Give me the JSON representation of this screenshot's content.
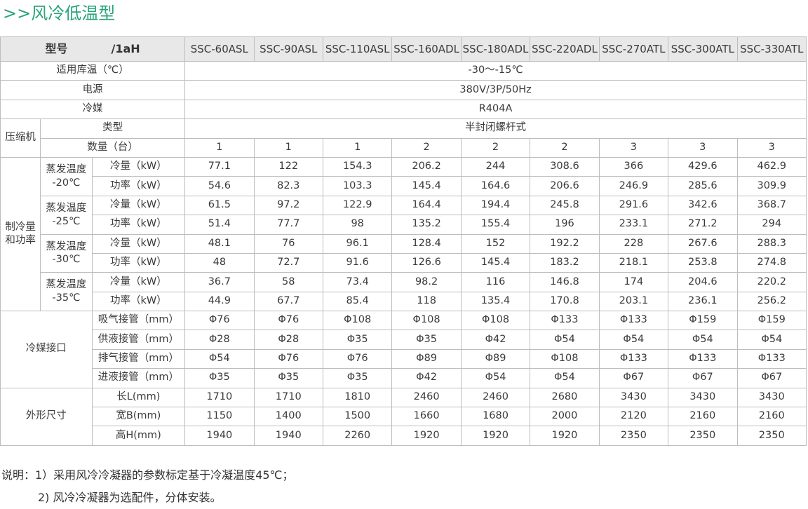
{
  "page_title": ">>风冷低温型",
  "table": {
    "header_label_a": "型号",
    "header_label_b": "/1aH",
    "models": [
      "SSC-60ASL",
      "SSC-90ASL",
      "SSC-110ASL",
      "SSC-160ADL",
      "SSC-180ADL",
      "SSC-220ADL",
      "SSC-270ATL",
      "SSC-300ATL",
      "SSC-330ATL"
    ],
    "common": [
      {
        "label": "适用库温（℃）",
        "value": "-30～-15℃"
      },
      {
        "label": "电源",
        "value": "380V/3P/50Hz"
      },
      {
        "label": "冷媒",
        "value": "R404A"
      }
    ],
    "compressor": {
      "group": "压缩机",
      "type_label": "类型",
      "type_value": "半封闭螺杆式",
      "count_label": "数量（台）",
      "count_values": [
        "1",
        "1",
        "1",
        "2",
        "2",
        "2",
        "3",
        "3",
        "3"
      ]
    },
    "capacity": {
      "group": "制冷量和功率",
      "row_labels": {
        "cool": "冷量（kW）",
        "power": "功率（kW）"
      },
      "temps": [
        {
          "label_line1": "蒸发温度",
          "label_line2": "-20℃",
          "cool": [
            "77.1",
            "122",
            "154.3",
            "206.2",
            "244",
            "308.6",
            "366",
            "429.6",
            "462.9"
          ],
          "power": [
            "54.6",
            "82.3",
            "103.3",
            "145.4",
            "164.6",
            "206.6",
            "246.9",
            "285.6",
            "309.9"
          ]
        },
        {
          "label_line1": "蒸发温度",
          "label_line2": "-25℃",
          "cool": [
            "61.5",
            "97.2",
            "122.9",
            "164.4",
            "194.4",
            "245.8",
            "291.6",
            "342.6",
            "368.7"
          ],
          "power": [
            "51.4",
            "77.7",
            "98",
            "135.2",
            "155.4",
            "196",
            "233.1",
            "271.2",
            "294"
          ]
        },
        {
          "label_line1": "蒸发温度",
          "label_line2": "-30℃",
          "cool": [
            "48.1",
            "76",
            "96.1",
            "128.4",
            "152",
            "192.2",
            "228",
            "267.6",
            "288.3"
          ],
          "power": [
            "48",
            "72.7",
            "91.6",
            "126.6",
            "145.4",
            "183.2",
            "218.1",
            "253.8",
            "274.8"
          ]
        },
        {
          "label_line1": "蒸发温度",
          "label_line2": "-35℃",
          "cool": [
            "36.7",
            "58",
            "73.4",
            "98.2",
            "116",
            "146.8",
            "174",
            "204.6",
            "220.2"
          ],
          "power": [
            "44.9",
            "67.7",
            "85.4",
            "118",
            "135.4",
            "170.8",
            "203.1",
            "236.1",
            "256.2"
          ]
        }
      ]
    },
    "connections": {
      "group": "冷媒接口",
      "rows": [
        {
          "label": "吸气接管（mm）",
          "values": [
            "Φ76",
            "Φ76",
            "Φ108",
            "Φ108",
            "Φ108",
            "Φ133",
            "Φ133",
            "Φ159",
            "Φ159"
          ]
        },
        {
          "label": "供液接管（mm）",
          "values": [
            "Φ28",
            "Φ28",
            "Φ35",
            "Φ35",
            "Φ42",
            "Φ54",
            "Φ54",
            "Φ54",
            "Φ54"
          ]
        },
        {
          "label": "排气接管（mm）",
          "values": [
            "Φ54",
            "Φ76",
            "Φ76",
            "Φ89",
            "Φ89",
            "Φ108",
            "Φ133",
            "Φ133",
            "Φ133"
          ]
        },
        {
          "label": "进液接管（mm）",
          "values": [
            "Φ35",
            "Φ35",
            "Φ35",
            "Φ42",
            "Φ54",
            "Φ54",
            "Φ67",
            "Φ67",
            "Φ67"
          ]
        }
      ]
    },
    "dimensions": {
      "group": "外形尺寸",
      "rows": [
        {
          "label": "长L(mm)",
          "values": [
            "1710",
            "1710",
            "1810",
            "2460",
            "2460",
            "2680",
            "3430",
            "3430",
            "3430"
          ]
        },
        {
          "label": "宽B(mm)",
          "values": [
            "1150",
            "1400",
            "1500",
            "1660",
            "1680",
            "2000",
            "2120",
            "2160",
            "2160"
          ]
        },
        {
          "label": "高H(mm)",
          "values": [
            "1940",
            "1940",
            "2260",
            "1920",
            "1920",
            "1920",
            "2350",
            "2350",
            "2350"
          ]
        }
      ]
    }
  },
  "notes": {
    "line1": "说明：1）采用风冷冷凝器的参数标定基于冷凝温度45℃；",
    "line2": "2) 风冷冷凝器为选配件，分体安装。"
  },
  "colors": {
    "title": "#2aa37a",
    "header_bg": "#e8e8e8",
    "border": "#bdbdbd"
  }
}
